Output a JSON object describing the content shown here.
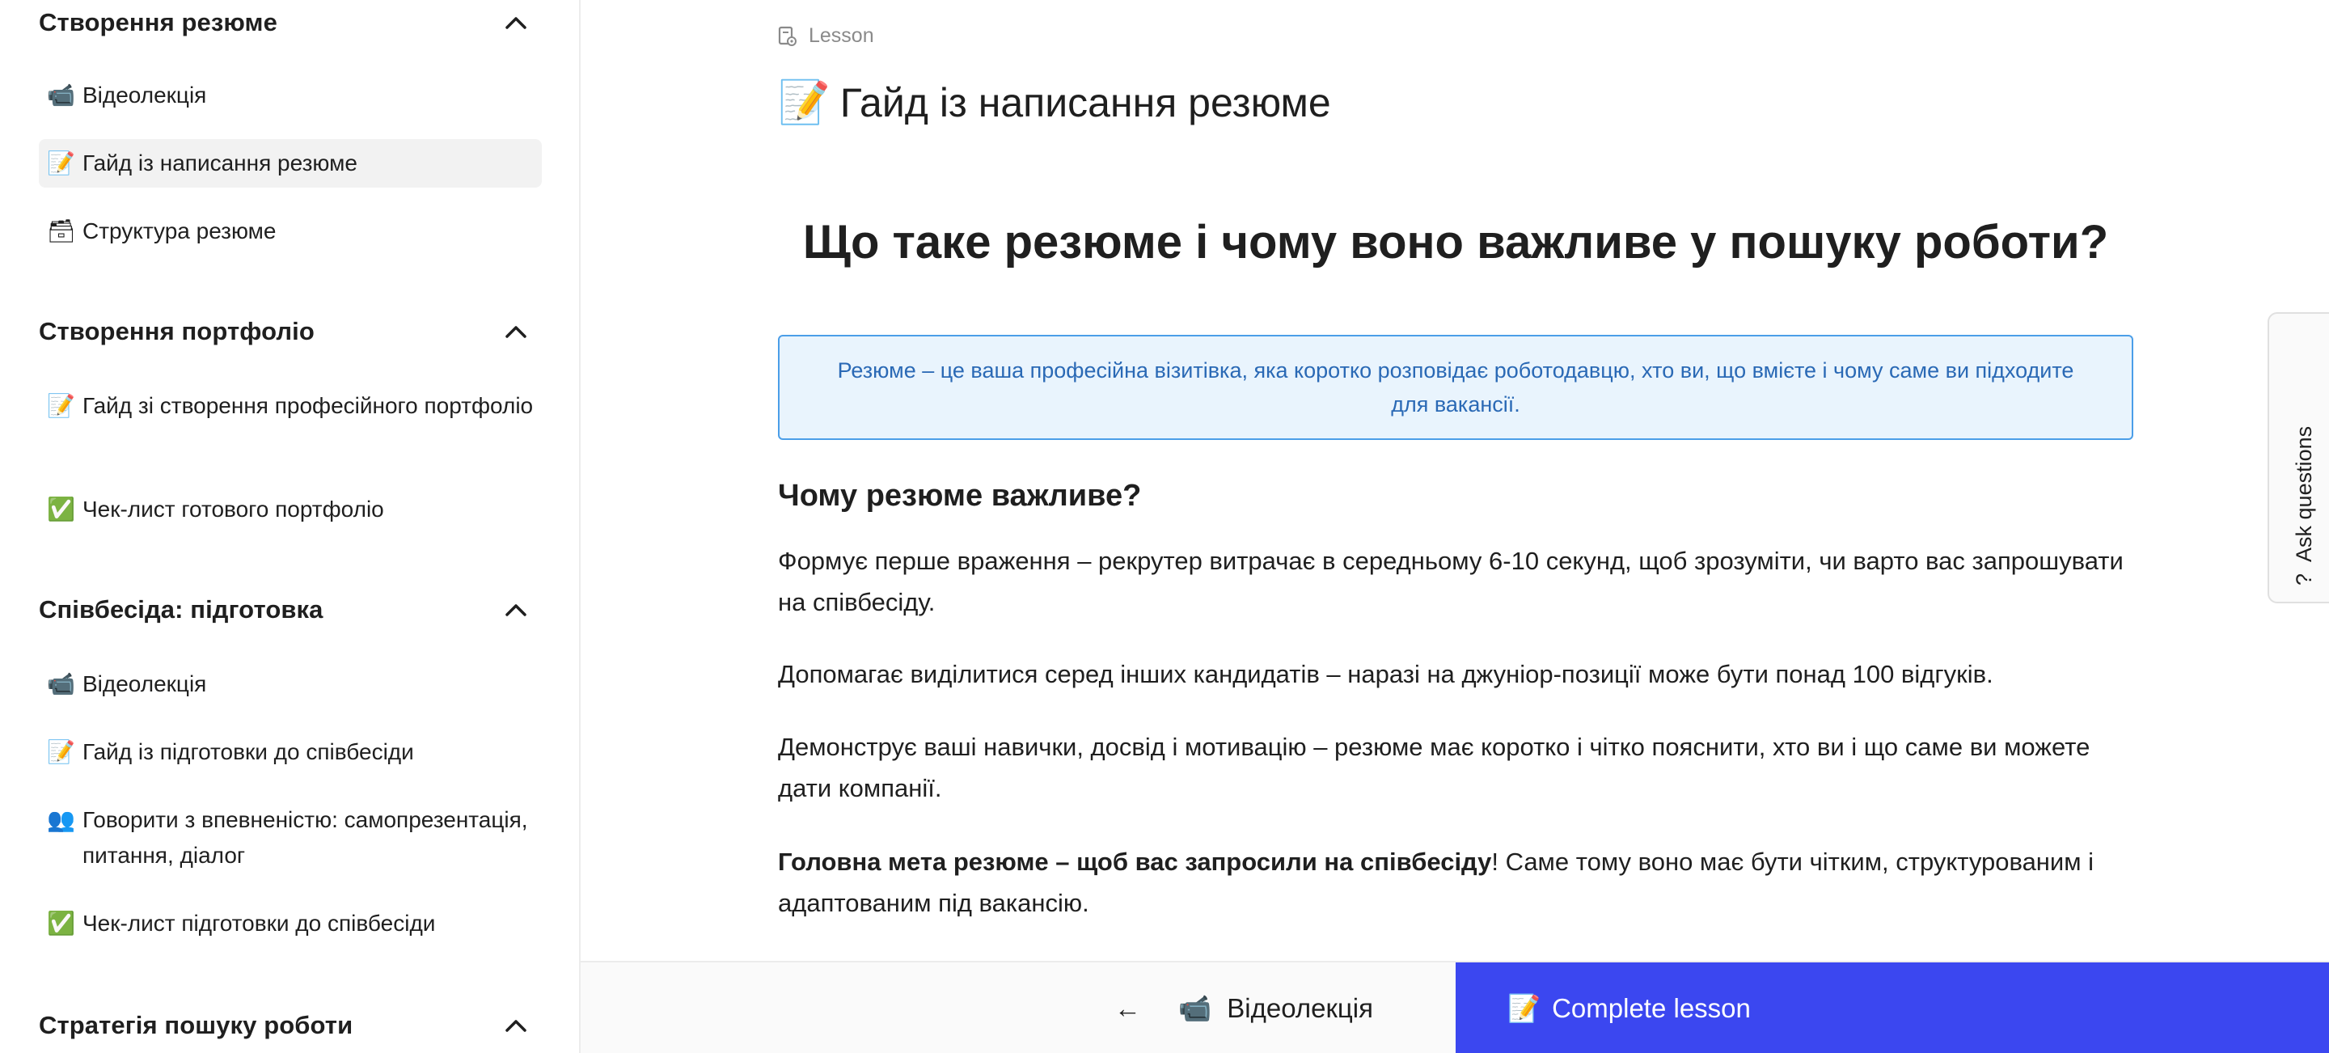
{
  "sidebar": {
    "sections": [
      {
        "title": "Створення резюме",
        "items": [
          {
            "icon": "📹",
            "label": "Відеолекція"
          },
          {
            "icon": "📝",
            "label": "Гайд із написання резюме"
          },
          {
            "icon": "🗃",
            "label": "Структура резюме"
          }
        ]
      },
      {
        "title": "Створення портфоліо",
        "items": [
          {
            "icon": "📝",
            "label": "Гайд зі створення професійного портфоліо"
          },
          {
            "icon": "✅",
            "label": "Чек-лист готового портфоліо"
          }
        ]
      },
      {
        "title": "Співбесіда: підготовка",
        "items": [
          {
            "icon": "📹",
            "label": "Відеолекція"
          },
          {
            "icon": "📝",
            "label": "Гайд із підготовки до співбесіди"
          },
          {
            "icon": "👥",
            "label": "Говорити з впевненістю: самопрезентація, питання, діалог"
          },
          {
            "icon": "✅",
            "label": "Чек-лист підготовки до співбесіди"
          }
        ]
      },
      {
        "title": "Стратегія пошуку роботи",
        "items": []
      }
    ]
  },
  "main": {
    "breadcrumb": "Lesson",
    "page_title_icon": "📝",
    "page_title": "Гайд із написання резюме",
    "heading": "Що таке резюме і чому воно важливе у пошуку роботи?",
    "callout": "Резюме – це ваша професійна візитівка, яка коротко розповідає роботодавцю, хто ви, що вмієте і чому саме ви підходите для вакансії.",
    "subheading": "Чому резюме важливе?",
    "paragraphs": [
      "Формує перше враження – рекрутер витрачає в середньому 6-10 секунд, щоб зрозуміти, чи варто вас запрошувати на співбесіду.",
      "Допомагає виділитися серед інших кандидатів – наразі на джуніор-позиції може бути понад 100 відгуків.",
      "Демонструє ваші навички, досвід і мотивацію – резюме має коротко і чітко пояснити, хто ви і що саме ви можете дати компанії."
    ],
    "last_paragraph_bold": "Головна мета резюме – щоб вас запросили на співбесіду",
    "last_paragraph_rest": "! Саме тому воно має бути чітким, структурованим і адаптованим під вакансію."
  },
  "ask_tab": {
    "icon": "?",
    "label": "Ask questions"
  },
  "bottom_bar": {
    "prev_arrow": "←",
    "prev_icon": "📹",
    "prev_label": "Відеолекція",
    "complete_icon": "📝",
    "complete_label": "Complete lesson"
  },
  "colors": {
    "accent": "#3b47f0",
    "callout_border": "#4b9ee8",
    "callout_bg": "#e9f4fd",
    "callout_text": "#2a69b5"
  }
}
